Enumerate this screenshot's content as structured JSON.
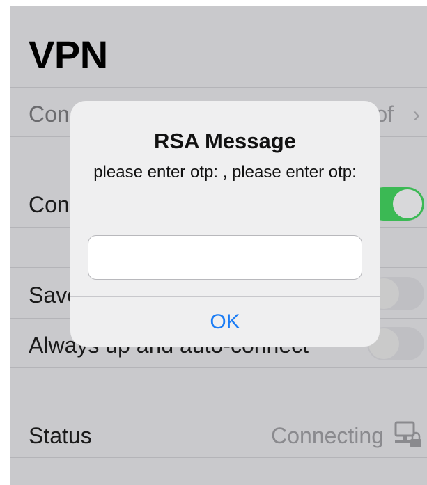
{
  "page": {
    "title": "VPN"
  },
  "rows": {
    "connection_label": "Con",
    "connection_value": "of",
    "connect_label": "Con",
    "save_label": "Save",
    "always_label": "Always up and auto-connect",
    "status_label": "Status",
    "status_value": "Connecting"
  },
  "toggles": {
    "connect": true,
    "save": false,
    "always": false
  },
  "dialog": {
    "title": "RSA Message",
    "message": "please enter otp: , please enter otp:",
    "input_value": "",
    "ok_label": "OK"
  },
  "icons": {
    "chevron": "chevron-right-icon",
    "status": "network-lock-icon"
  },
  "colors": {
    "toggle_on": "#3bb954",
    "accent": "#1a7cf5",
    "background": "#c9c9cc"
  }
}
